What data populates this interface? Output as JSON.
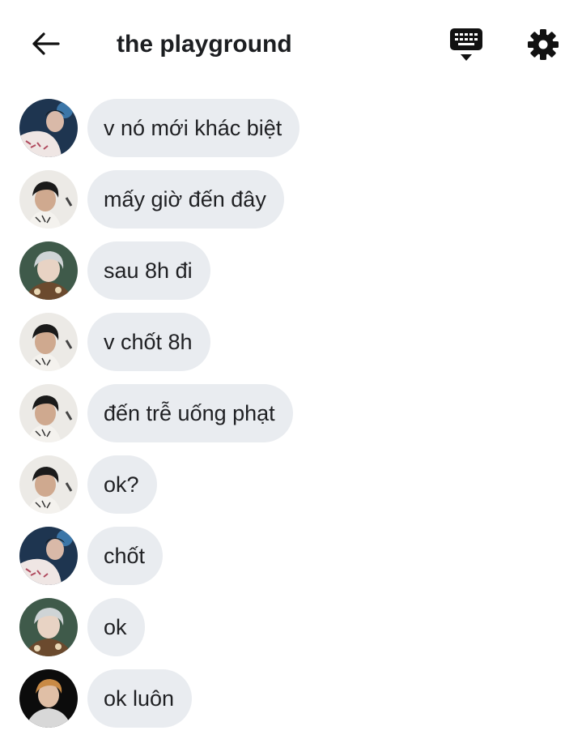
{
  "header": {
    "title": "the playground",
    "back_icon": "arrow-left-icon",
    "keyboard_icon": "keyboard-icon",
    "settings_icon": "gear-icon"
  },
  "colors": {
    "bubble_bg": "#e9ecf0",
    "text": "#1c1e21",
    "background": "#ffffff"
  },
  "messages": [
    {
      "avatar": "user-a",
      "text": "v nó mới khác biệt"
    },
    {
      "avatar": "user-b",
      "text": "mấy giờ đến đây"
    },
    {
      "avatar": "user-c",
      "text": "sau 8h đi"
    },
    {
      "avatar": "user-b",
      "text": "v chốt 8h"
    },
    {
      "avatar": "user-b",
      "text": "đến trễ uống phạt"
    },
    {
      "avatar": "user-b",
      "text": "ok?"
    },
    {
      "avatar": "user-a",
      "text": "chốt"
    },
    {
      "avatar": "user-c",
      "text": "ok"
    },
    {
      "avatar": "user-d",
      "text": "ok luôn"
    }
  ]
}
